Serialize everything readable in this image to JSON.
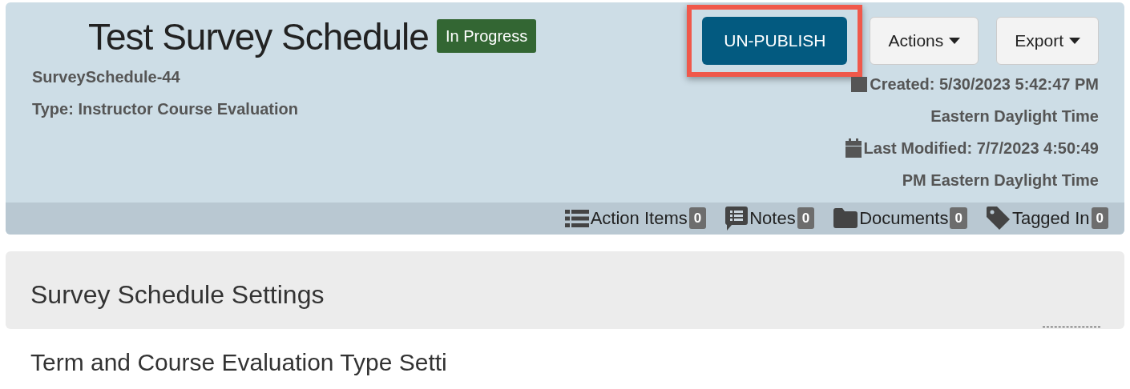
{
  "header": {
    "title": "Test Survey Schedule",
    "status": "In Progress",
    "buttons": [
      {
        "label": "UN-PUBLISH",
        "kind": "primary",
        "highlighted": true,
        "dropdown": false
      },
      {
        "label": "Actions",
        "kind": "light",
        "highlighted": false,
        "dropdown": true
      },
      {
        "label": "Export",
        "kind": "light",
        "highlighted": false,
        "dropdown": true
      }
    ],
    "identifier": "SurveySchedule-44",
    "type": "Type: Instructor Course Evaluation",
    "created": "Created: 5/30/2023 5:42:47 PM\nEastern Daylight Time",
    "modified": "Last Modified: 7/7/2023 4:50:49\nPM Eastern Daylight Time",
    "counters": [
      {
        "kind": "list",
        "label": "Action Items",
        "count": "0"
      },
      {
        "kind": "notes",
        "label": "Notes",
        "count": "0"
      },
      {
        "kind": "folder",
        "label": "Documents",
        "count": "0"
      },
      {
        "kind": "tag",
        "label": "Tagged In",
        "count": "0"
      }
    ]
  },
  "settings_panel": {
    "title": "Survey Schedule Settings"
  },
  "section_heading": "Term and Course Evaluation Type Setti"
}
